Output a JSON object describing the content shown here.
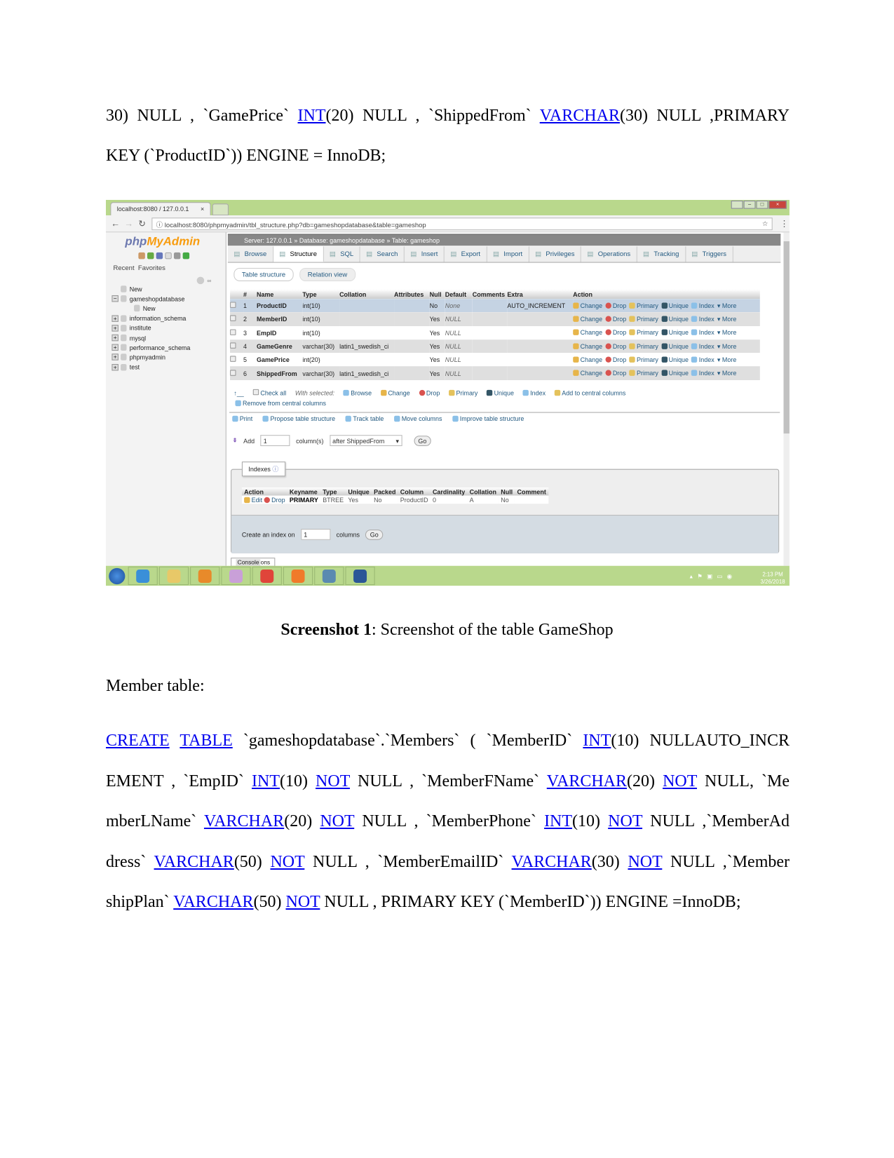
{
  "doc": {
    "intro_lines": [
      [
        {
          "t": "30) NULL , `GamePrice` "
        },
        {
          "t": "INT",
          "link": true
        },
        {
          "t": "(20) NULL , `ShippedFrom` "
        },
        {
          "t": "VARCHAR",
          "link": true
        },
        {
          "t": "(30) NULL ,PRIMARY"
        }
      ],
      [
        {
          "t": "KEY (`ProductID`)) ENGINE = InnoDB;"
        }
      ]
    ],
    "caption_bold": "Screenshot 1",
    "caption_text": ": Screenshot of the table GameShop",
    "section_label": "Member table:",
    "member_lines": [
      [
        {
          "t": "CREATE",
          "link": true
        },
        {
          "t": " "
        },
        {
          "t": "TABLE",
          "link": true
        },
        {
          "t": " `gameshopdatabase`.`Members` ( `MemberID` "
        },
        {
          "t": "INT",
          "link": true
        },
        {
          "t": "(10) NULLAUTO_INCR"
        }
      ],
      [
        {
          "t": "EMENT , `EmpID` "
        },
        {
          "t": "INT",
          "link": true
        },
        {
          "t": "(10) "
        },
        {
          "t": "NOT",
          "link": true
        },
        {
          "t": " NULL , `MemberFName` "
        },
        {
          "t": "VARCHAR",
          "link": true
        },
        {
          "t": "(20) "
        },
        {
          "t": "NOT",
          "link": true
        },
        {
          "t": " NULL, `Me"
        }
      ],
      [
        {
          "t": "mberLName` "
        },
        {
          "t": "VARCHAR",
          "link": true
        },
        {
          "t": "(20) "
        },
        {
          "t": "NOT",
          "link": true
        },
        {
          "t": " NULL , `MemberPhone` "
        },
        {
          "t": "INT",
          "link": true
        },
        {
          "t": "(10) "
        },
        {
          "t": "NOT",
          "link": true
        },
        {
          "t": " NULL ,`MemberAd"
        }
      ],
      [
        {
          "t": "dress` "
        },
        {
          "t": "VARCHAR",
          "link": true
        },
        {
          "t": "(50) "
        },
        {
          "t": "NOT",
          "link": true
        },
        {
          "t": " NULL , `MemberEmailID` "
        },
        {
          "t": "VARCHAR",
          "link": true
        },
        {
          "t": "(30) "
        },
        {
          "t": "NOT",
          "link": true
        },
        {
          "t": " NULL ,`Member"
        }
      ],
      [
        {
          "t": "shipPlan` "
        },
        {
          "t": "VARCHAR",
          "link": true
        },
        {
          "t": "(50) "
        },
        {
          "t": "NOT",
          "link": true
        },
        {
          "t": " NULL , PRIMARY KEY (`MemberID`)) ENGINE =InnoDB;"
        }
      ]
    ],
    "link_color": "#0000ee"
  },
  "shot": {
    "browser_tab": "localhost:8080 / 127.0.0.1",
    "url": "localhost:8080/phpmyadmin/tbl_structure.php?db=gameshopdatabase&table=gameshop",
    "logo_php": "php",
    "logo_my": "MyAdmin",
    "recent": "Recent",
    "favorites": "Favorites",
    "tree": [
      {
        "label": "New",
        "toggle": "",
        "indent": 0
      },
      {
        "label": "gameshopdatabase",
        "toggle": "−",
        "indent": 0
      },
      {
        "label": "New",
        "toggle": "",
        "indent": 1
      },
      {
        "label": "information_schema",
        "toggle": "+",
        "indent": 0
      },
      {
        "label": "institute",
        "toggle": "+",
        "indent": 0
      },
      {
        "label": "mysql",
        "toggle": "+",
        "indent": 0
      },
      {
        "label": "performance_schema",
        "toggle": "+",
        "indent": 0
      },
      {
        "label": "phpmyadmin",
        "toggle": "+",
        "indent": 0
      },
      {
        "label": "test",
        "toggle": "+",
        "indent": 0
      }
    ],
    "breadcrumb": {
      "server": "Server: 127.0.0.1",
      "database": "Database: gameshopdatabase",
      "table": "Table: gameshop",
      "sep": "»"
    },
    "tabs": [
      "Browse",
      "Structure",
      "SQL",
      "Search",
      "Insert",
      "Export",
      "Import",
      "Privileges",
      "Operations",
      "Tracking",
      "Triggers"
    ],
    "active_tab": "Structure",
    "subtabs": [
      "Table structure",
      "Relation view"
    ],
    "headers": [
      "",
      "#",
      "Name",
      "Type",
      "Collation",
      "Attributes",
      "Null",
      "Default",
      "Comments",
      "Extra",
      "Action"
    ],
    "rows": [
      {
        "n": "1",
        "name": "ProductID",
        "type": "int(10)",
        "collation": "",
        "attributes": "",
        "null": "No",
        "default": "None",
        "comments": "",
        "extra": "AUTO_INCREMENT"
      },
      {
        "n": "2",
        "name": "MemberID",
        "type": "int(10)",
        "collation": "",
        "attributes": "",
        "null": "Yes",
        "default": "NULL",
        "comments": "",
        "extra": ""
      },
      {
        "n": "3",
        "name": "EmpID",
        "type": "int(10)",
        "collation": "",
        "attributes": "",
        "null": "Yes",
        "default": "NULL",
        "comments": "",
        "extra": ""
      },
      {
        "n": "4",
        "name": "GameGenre",
        "type": "varchar(30)",
        "collation": "latin1_swedish_ci",
        "attributes": "",
        "null": "Yes",
        "default": "NULL",
        "comments": "",
        "extra": ""
      },
      {
        "n": "5",
        "name": "GamePrice",
        "type": "int(20)",
        "collation": "",
        "attributes": "",
        "null": "Yes",
        "default": "NULL",
        "comments": "",
        "extra": ""
      },
      {
        "n": "6",
        "name": "ShippedFrom",
        "type": "varchar(30)",
        "collation": "latin1_swedish_ci",
        "attributes": "",
        "null": "Yes",
        "default": "NULL",
        "comments": "",
        "extra": ""
      }
    ],
    "row_actions": [
      "Change",
      "Drop",
      "Primary",
      "Unique",
      "Index",
      "More"
    ],
    "check_all": "Check all",
    "with_selected": "With selected:",
    "bulk_actions": [
      "Browse",
      "Change",
      "Drop",
      "Primary",
      "Unique",
      "Index",
      "Add to central columns"
    ],
    "remove_central": "Remove from central columns",
    "tools": [
      "Print",
      "Propose table structure",
      "Track table",
      "Move columns",
      "Improve table structure"
    ],
    "add": {
      "label": "Add",
      "value": "1",
      "unit": "column(s)",
      "position": "after ShippedFrom",
      "go": "Go"
    },
    "indexes": {
      "legend": "Indexes",
      "headers": [
        "Action",
        "Keyname",
        "Type",
        "Unique",
        "Packed",
        "Column",
        "Cardinality",
        "Collation",
        "Null",
        "Comment"
      ],
      "row": {
        "edit": "Edit",
        "drop": "Drop",
        "keyname": "PRIMARY",
        "type": "BTREE",
        "unique": "Yes",
        "packed": "No",
        "column": "ProductID",
        "cardinality": "0",
        "collation": "A",
        "null": "No",
        "comment": ""
      },
      "create_label": "Create an index on",
      "create_value": "1",
      "create_unit": "columns",
      "go": "Go"
    },
    "console": "Console",
    "console_rest": "ons",
    "clock_time": "2:13 PM",
    "clock_date": "3/26/2018",
    "taskbar_apps": [
      "internet-explorer",
      "file-explorer",
      "media-player",
      "paint",
      "chrome",
      "xampp",
      "photos",
      "word"
    ]
  }
}
